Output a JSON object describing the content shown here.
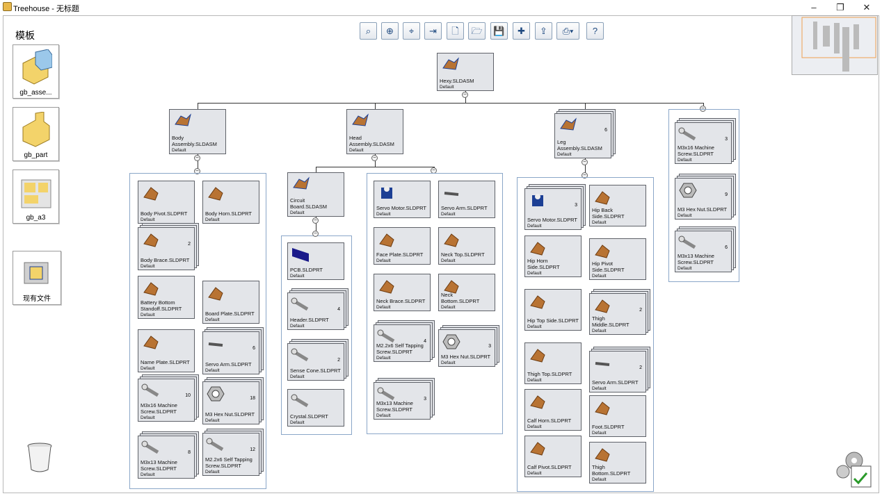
{
  "window": {
    "title": "Treehouse - 无标题",
    "min": "–",
    "max": "❐",
    "close": "✕"
  },
  "sidebar": {
    "heading": "模板",
    "templates": [
      {
        "label": "gb_asse...",
        "icon": "assembly-icon"
      },
      {
        "label": "gb_part",
        "icon": "part-icon"
      },
      {
        "label": "gb_a3",
        "icon": "drawing-icon"
      }
    ],
    "existing": {
      "label": "现有文件",
      "icon": "folder-icon"
    }
  },
  "toolbar": {
    "buttons": [
      {
        "name": "zoom-fit-icon",
        "glyph": "⌕"
      },
      {
        "name": "zoom-area-icon",
        "glyph": "⊕"
      },
      {
        "name": "zoom-selection-icon",
        "glyph": "⌖"
      },
      {
        "name": "insert-icon",
        "glyph": "⇥"
      },
      {
        "name": "new-file-icon",
        "glyph": "🗋"
      },
      {
        "name": "open-folder-icon",
        "glyph": "🗁"
      },
      {
        "name": "save-icon",
        "glyph": "💾"
      },
      {
        "name": "add-component-icon",
        "glyph": "✚"
      },
      {
        "name": "export-icon",
        "glyph": "⇪"
      },
      {
        "name": "print-icon",
        "glyph": "⎙▾"
      },
      {
        "name": "help-icon",
        "glyph": "?"
      }
    ]
  },
  "root": {
    "name": "Hexy.SLDASM",
    "config": "Default"
  },
  "assemblies": [
    {
      "name": "Body Assembly.SLDASM",
      "config": "Default",
      "qty": ""
    },
    {
      "name": "Head Assembly.SLDASM",
      "config": "Default",
      "qty": ""
    },
    {
      "name": "Leg Assembly.SLDASM",
      "config": "Default",
      "qty": "6"
    },
    {
      "name": "Circuit Board.SLDASM",
      "config": "Default",
      "qty": ""
    }
  ],
  "parts": {
    "body": [
      {
        "name": "Body Pivot.SLDPRT",
        "config": "Default",
        "qty": ""
      },
      {
        "name": "Body Horn.SLDPRT",
        "config": "Default",
        "qty": ""
      },
      {
        "name": "Body Brace.SLDPRT",
        "config": "Default",
        "qty": "2"
      },
      {
        "name": "Battery Bottom.SLDPRT",
        "config": "Default",
        "qty": ""
      },
      {
        "name": "Battery Bottom Standoff.SLDPRT",
        "config": "Default",
        "qty": ""
      },
      {
        "name": "Board Plate.SLDPRT",
        "config": "Default",
        "qty": ""
      },
      {
        "name": "Name Plate.SLDPRT",
        "config": "Default",
        "qty": ""
      },
      {
        "name": "Servo Arm.SLDPRT",
        "config": "Default",
        "qty": "6"
      },
      {
        "name": "M3x16 Machine Screw.SLDPRT",
        "config": "Default",
        "qty": "10"
      },
      {
        "name": "M3 Hex Nut.SLDPRT",
        "config": "Default",
        "qty": "18"
      },
      {
        "name": "M3x13 Machine Screw.SLDPRT",
        "config": "Default",
        "qty": "8"
      },
      {
        "name": "M2.2x6 Self Tapping Screw.SLDPRT",
        "config": "Default",
        "qty": "12"
      }
    ],
    "board": [
      {
        "name": "PCB.SLDPRT",
        "config": "Default",
        "qty": ""
      },
      {
        "name": "Header.SLDPRT",
        "config": "Default",
        "qty": "4"
      },
      {
        "name": "Sense Cone.SLDPRT",
        "config": "Default",
        "qty": "2"
      },
      {
        "name": "Crystal.SLDPRT",
        "config": "Default",
        "qty": ""
      }
    ],
    "head": [
      {
        "name": "Servo Motor.SLDPRT",
        "config": "Default",
        "qty": ""
      },
      {
        "name": "Servo Arm.SLDPRT",
        "config": "Default",
        "qty": ""
      },
      {
        "name": "Face Plate.SLDPRT",
        "config": "Default",
        "qty": ""
      },
      {
        "name": "Neck Top.SLDPRT",
        "config": "Default",
        "qty": ""
      },
      {
        "name": "Neck Brace.SLDPRT",
        "config": "Default",
        "qty": ""
      },
      {
        "name": "Neck Bottom.SLDPRT",
        "config": "Default",
        "qty": ""
      },
      {
        "name": "M2.2x6 Self Tapping Screw.SLDPRT",
        "config": "Default",
        "qty": "4"
      },
      {
        "name": "M3 Hex Nut.SLDPRT",
        "config": "Default",
        "qty": "3"
      },
      {
        "name": "M3x13 Machine Screw.SLDPRT",
        "config": "Default",
        "qty": "3"
      }
    ],
    "leg": [
      {
        "name": "Servo Motor.SLDPRT",
        "config": "Default",
        "qty": "3"
      },
      {
        "name": "Hip Back Side.SLDPRT",
        "config": "Default",
        "qty": ""
      },
      {
        "name": "Hip Horn Side.SLDPRT",
        "config": "Default",
        "qty": ""
      },
      {
        "name": "Hip Pivot Side.SLDPRT",
        "config": "Default",
        "qty": ""
      },
      {
        "name": "Hip Top Side.SLDPRT",
        "config": "Default",
        "qty": ""
      },
      {
        "name": "Thigh Middle.SLDPRT",
        "config": "Default",
        "qty": "2"
      },
      {
        "name": "Thigh Top.SLDPRT",
        "config": "Default",
        "qty": ""
      },
      {
        "name": "Servo Arm.SLDPRT",
        "config": "Default",
        "qty": "2"
      },
      {
        "name": "Calf Horn.SLDPRT",
        "config": "Default",
        "qty": ""
      },
      {
        "name": "Foot.SLDPRT",
        "config": "Default",
        "qty": ""
      },
      {
        "name": "Calf Pivot.SLDPRT",
        "config": "Default",
        "qty": ""
      },
      {
        "name": "Thigh Bottom.SLDPRT",
        "config": "Default",
        "qty": ""
      }
    ],
    "misc": [
      {
        "name": "M3x16 Machine Screw.SLDPRT",
        "config": "Default",
        "qty": "3"
      },
      {
        "name": "M3 Hex Nut.SLDPRT",
        "config": "Default",
        "qty": "9"
      },
      {
        "name": "M3x13 Machine Screw.SLDPRT",
        "config": "Default",
        "qty": "6"
      }
    ]
  },
  "colors": {
    "bronze": "#b87333",
    "servo": "#1c3f94",
    "steel": "#888888",
    "pcb": "#1a1a8a"
  }
}
